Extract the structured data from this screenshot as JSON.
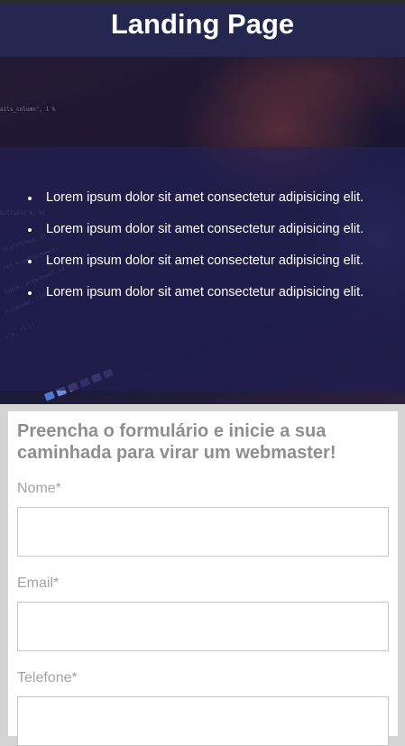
{
  "header": {
    "title": "Landing Page"
  },
  "hero": {
    "features": [
      "Lorem ipsum dolor sit amet consectetur adipisicing elit.",
      "Lorem ipsum dolor sit amet consectetur adipisicing elit.",
      "Lorem ipsum dolor sit amet consectetur adipisicing elit.",
      "Lorem ipsum dolor sit amet consectetur adipisicing elit."
    ],
    "background_image": "laptop-code-photo"
  },
  "form": {
    "title": "Preencha o formulário e inicie a sua caminhada para virar um webmaster!",
    "fields": [
      {
        "label": "Nome*",
        "value": ""
      },
      {
        "label": "Email*",
        "value": ""
      },
      {
        "label": "Telefone*",
        "value": ""
      }
    ]
  },
  "colors": {
    "header_bg": "#242850",
    "panel_overlay": "#201e50",
    "page_bg": "#d4d4d4",
    "form_bg": "#ffffff",
    "label_text": "#a3a3a3"
  }
}
